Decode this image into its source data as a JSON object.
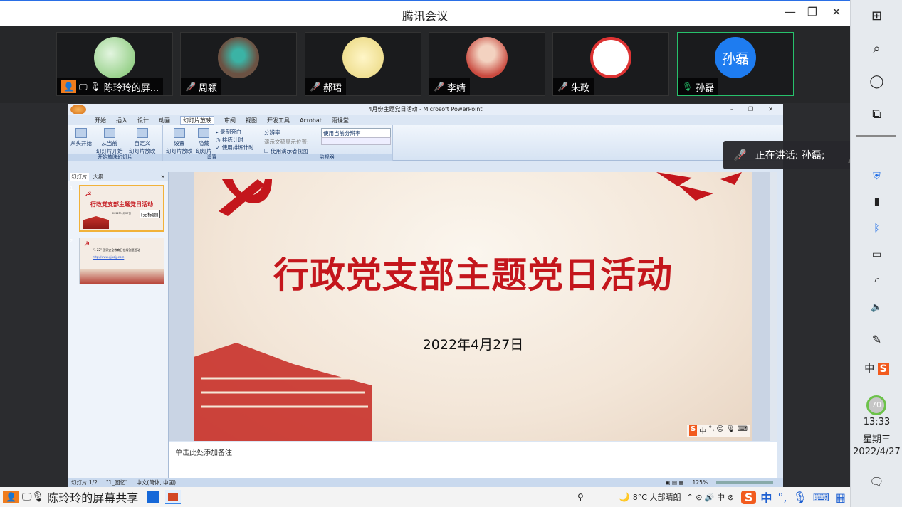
{
  "app": {
    "title": "腾讯会议",
    "minimize": "—",
    "maximize": "❐",
    "close": "✕"
  },
  "participants": [
    {
      "name": "陈玲玲的屏...",
      "avatar_color": "#7bc36a"
    },
    {
      "name": "周颖",
      "avatar_color": "#6b5243"
    },
    {
      "name": "郝珺",
      "avatar_color": "#e8d57a"
    },
    {
      "name": "李婧",
      "avatar_color": "#c94a3f"
    },
    {
      "name": "朱政",
      "avatar_color": "#e9dede"
    },
    {
      "name": "孙磊",
      "avatar_text": "孙磊",
      "avatar_color": "#1e7cf0"
    }
  ],
  "speaking": {
    "label": "正在讲话: 孙磊;"
  },
  "ppt": {
    "title": "4月份主题党日活动 - Microsoft PowerPoint",
    "tabs": [
      "开始",
      "插入",
      "设计",
      "动画",
      "幻灯片放映",
      "审阅",
      "视图",
      "开发工具",
      "Acrobat",
      "雨课堂"
    ],
    "ribbon": {
      "btn1": "从头开始",
      "btn2a": "从当前",
      "btn2b": "幻灯片开始",
      "btn3a": "自定义",
      "btn3b": "幻灯片放映",
      "group1": "开始放映幻灯片",
      "btn4a": "设置",
      "btn4b": "幻灯片放映",
      "btn5a": "隐藏",
      "btn5b": "幻灯片",
      "opt1": "录制旁白",
      "opt2": "排练计时",
      "opt3": "使用排练计时",
      "group2": "设置",
      "res_label": "分辨率:",
      "res_value": "使用当前分辨率",
      "show_on": "演示文稿显示位置:",
      "presenter": "使用演示者视图",
      "group3": "监视器"
    },
    "pane_tabs": [
      "幻灯片",
      "大纲"
    ],
    "thumb1_title": "行政党支部主题党日活动",
    "thumb1_date": "2022年4月27日",
    "thumb1_tooltip": "[无标题]",
    "thumb2_text": "“1·22” 国家安全教育日在线答题活动",
    "thumb2_url": "http://www.gjaqjy.com",
    "slide_title": "行政党支部主题党日活动",
    "slide_date": "2022年4月27日",
    "notes_placeholder": "单击此处添加备注",
    "status": {
      "slide": "幻灯片 1/2",
      "theme": "\"1_回忆\"",
      "lang": "中文(简体, 中国)",
      "zoom": "125%"
    }
  },
  "bottombar": {
    "share_label": "陈玲玲的屏幕共享",
    "weather": "8°C 大部晴朗",
    "ime": "中"
  },
  "winbar": {
    "time": "13:33",
    "weekday": "星期三",
    "date": "2022/4/27",
    "cpu": "70"
  }
}
